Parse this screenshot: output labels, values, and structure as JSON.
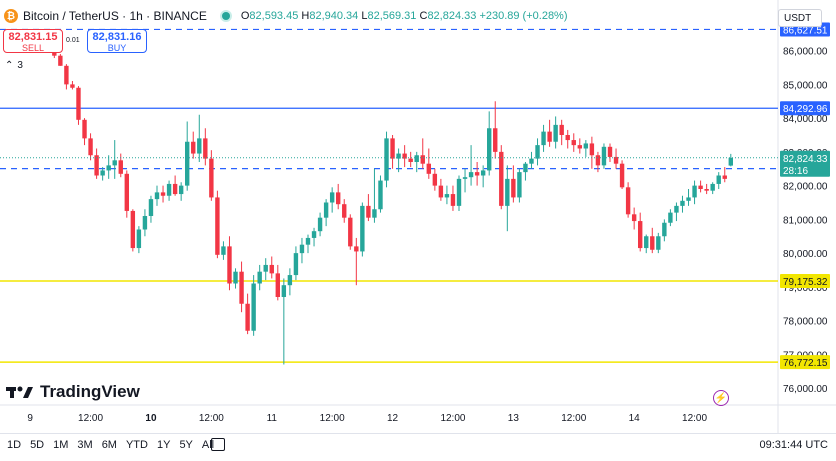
{
  "header": {
    "coin_glyph": "₿",
    "title": "Bitcoin / TetherUS · 1h · BINANCE",
    "open": "82,593.45",
    "high": "82,940.34",
    "low": "82,569.31",
    "close": "82,824.33",
    "change": "+230.89 (+0.28%)",
    "o_label": "O",
    "h_label": "H",
    "l_label": "L",
    "c_label": "C"
  },
  "trade": {
    "sell_price": "82,831.15",
    "sell_label": "SELL",
    "buy_price": "82,831.16",
    "buy_label": "BUY",
    "spread": "0.01"
  },
  "indicators_collapsed": "3",
  "currency_selector": "USDT",
  "brand": "TradingView",
  "ranges": [
    "1D",
    "5D",
    "1M",
    "3M",
    "6M",
    "YTD",
    "1Y",
    "5Y",
    "All"
  ],
  "clock": "09:31:44 UTC",
  "chart_data": {
    "type": "candlestick",
    "ylim": [
      75500,
      87500
    ],
    "y_ticks": [
      76000,
      77000,
      78000,
      79000,
      80000,
      81000,
      82000,
      83000,
      84000,
      85000,
      86000
    ],
    "y_tick_labels": [
      "76,000.00",
      "77,000.00",
      "78,000.00",
      "79,000.00",
      "80,000.00",
      "81,000.00",
      "82,000.00",
      "83,000.00",
      "84,000.00",
      "85,000.00",
      "86,000.00"
    ],
    "x_ticks": [
      "9",
      "12:00",
      "10",
      "12:00",
      "11",
      "12:00",
      "12",
      "12:00",
      "13",
      "12:00",
      "14",
      "12:00"
    ],
    "x_tick_bold": [
      false,
      false,
      true,
      false,
      false,
      false,
      false,
      false,
      false,
      false,
      false,
      false
    ],
    "x_tick_candle_index": [
      4,
      14,
      24,
      34,
      44,
      54,
      64,
      74,
      84,
      94,
      104,
      114
    ],
    "colors": {
      "up": "#26a69a",
      "down": "#f23645",
      "blue": "#2962ff",
      "yellow": "#f2e600"
    },
    "candles": [
      [
        86170,
        86300,
        86150,
        86180
      ],
      [
        86180,
        86240,
        86100,
        86200
      ],
      [
        86200,
        86280,
        86160,
        86250
      ],
      [
        86250,
        86330,
        86180,
        86280
      ],
      [
        86280,
        86330,
        86080,
        86120
      ],
      [
        86120,
        86200,
        86050,
        86080
      ],
      [
        86080,
        86150,
        85950,
        86010
      ],
      [
        86010,
        86120,
        85950,
        86050
      ],
      [
        86050,
        86120,
        85780,
        85850
      ],
      [
        85850,
        85900,
        85550,
        85550
      ],
      [
        85550,
        85600,
        84850,
        85000
      ],
      [
        85000,
        85100,
        84850,
        84900
      ],
      [
        84900,
        84950,
        83800,
        83950
      ],
      [
        83950,
        84000,
        83200,
        83400
      ],
      [
        83400,
        83550,
        82750,
        82900
      ],
      [
        82900,
        83100,
        82200,
        82300
      ],
      [
        82300,
        82550,
        82150,
        82450
      ],
      [
        82450,
        82900,
        82200,
        82600
      ],
      [
        82600,
        83350,
        82200,
        82750
      ],
      [
        82750,
        82950,
        82250,
        82350
      ],
      [
        82350,
        82450,
        81050,
        81250
      ],
      [
        81250,
        81300,
        80050,
        80150
      ],
      [
        80150,
        80800,
        80000,
        80700
      ],
      [
        80700,
        81300,
        80500,
        81100
      ],
      [
        81100,
        81700,
        80900,
        81600
      ],
      [
        81600,
        82000,
        81400,
        81800
      ],
      [
        81800,
        82000,
        81500,
        81700
      ],
      [
        81700,
        82150,
        81550,
        82050
      ],
      [
        82050,
        82300,
        81700,
        81750
      ],
      [
        81750,
        82100,
        81550,
        82000
      ],
      [
        82000,
        83900,
        81850,
        83300
      ],
      [
        83300,
        83600,
        82800,
        82950
      ],
      [
        82950,
        84100,
        82700,
        83400
      ],
      [
        83400,
        83700,
        82600,
        82800
      ],
      [
        82800,
        83050,
        81550,
        81650
      ],
      [
        81650,
        81850,
        79850,
        79950
      ],
      [
        79950,
        80350,
        79800,
        80200
      ],
      [
        80200,
        80500,
        78900,
        79100
      ],
      [
        79100,
        79550,
        78950,
        79450
      ],
      [
        79450,
        79750,
        78250,
        78500
      ],
      [
        78500,
        78800,
        77600,
        77700
      ],
      [
        77700,
        79350,
        77550,
        79100
      ],
      [
        79100,
        79650,
        78900,
        79450
      ],
      [
        79450,
        79850,
        79200,
        79650
      ],
      [
        79650,
        79900,
        79250,
        79400
      ],
      [
        79400,
        79650,
        78600,
        78700
      ],
      [
        78700,
        79250,
        76700,
        79050
      ],
      [
        79050,
        79550,
        78750,
        79350
      ],
      [
        79350,
        80200,
        79200,
        80000
      ],
      [
        80000,
        80450,
        79700,
        80250
      ],
      [
        80250,
        80550,
        80000,
        80450
      ],
      [
        80450,
        80750,
        80200,
        80650
      ],
      [
        80650,
        81200,
        80500,
        81050
      ],
      [
        81050,
        81600,
        80800,
        81500
      ],
      [
        81500,
        81950,
        81200,
        81800
      ],
      [
        81800,
        82050,
        81300,
        81450
      ],
      [
        81450,
        81600,
        80900,
        81050
      ],
      [
        81050,
        81150,
        80100,
        80200
      ],
      [
        80200,
        80450,
        79050,
        80050
      ],
      [
        80050,
        81500,
        79900,
        81400
      ],
      [
        81400,
        81750,
        80950,
        81050
      ],
      [
        81050,
        82500,
        80900,
        81300
      ],
      [
        81300,
        82300,
        81200,
        82150
      ],
      [
        82150,
        83600,
        81950,
        83400
      ],
      [
        83400,
        83500,
        82500,
        82800
      ],
      [
        82800,
        83100,
        82400,
        82950
      ],
      [
        82950,
        83200,
        82550,
        82800
      ],
      [
        82800,
        83000,
        82550,
        82700
      ],
      [
        82700,
        83000,
        82400,
        82900
      ],
      [
        82900,
        83400,
        82500,
        82650
      ],
      [
        82650,
        83100,
        82200,
        82350
      ],
      [
        82350,
        82500,
        81850,
        82000
      ],
      [
        82000,
        82200,
        81550,
        81650
      ],
      [
        81650,
        82000,
        81450,
        81750
      ],
      [
        81750,
        82000,
        81250,
        81400
      ],
      [
        81400,
        82300,
        81250,
        82200
      ],
      [
        82200,
        82500,
        81800,
        82250
      ],
      [
        82250,
        83200,
        82000,
        82400
      ],
      [
        82400,
        82700,
        82000,
        82300
      ],
      [
        82300,
        82600,
        81950,
        82450
      ],
      [
        82450,
        84200,
        82300,
        83700
      ],
      [
        83700,
        84500,
        82800,
        83000
      ],
      [
        83000,
        83200,
        81300,
        81400
      ],
      [
        81400,
        82600,
        80650,
        82200
      ],
      [
        82200,
        82600,
        81500,
        81650
      ],
      [
        81650,
        82500,
        81500,
        82400
      ],
      [
        82400,
        82700,
        82150,
        82650
      ],
      [
        82650,
        83000,
        82500,
        82800
      ],
      [
        82800,
        83400,
        82600,
        83200
      ],
      [
        83200,
        83800,
        83000,
        83600
      ],
      [
        83600,
        83950,
        83150,
        83300
      ],
      [
        83300,
        84050,
        83100,
        83800
      ],
      [
        83800,
        83950,
        83200,
        83500
      ],
      [
        83500,
        83650,
        83100,
        83350
      ],
      [
        83350,
        83550,
        83000,
        83200
      ],
      [
        83200,
        83400,
        82950,
        83100
      ],
      [
        83100,
        83350,
        82850,
        83250
      ],
      [
        83250,
        83450,
        82500,
        82900
      ],
      [
        82900,
        83000,
        82400,
        82600
      ],
      [
        82600,
        83250,
        82500,
        83150
      ],
      [
        83150,
        83250,
        82700,
        82850
      ],
      [
        82850,
        83100,
        82500,
        82650
      ],
      [
        82650,
        82750,
        81900,
        81950
      ],
      [
        81950,
        82100,
        81050,
        81150
      ],
      [
        81150,
        81350,
        80700,
        80950
      ],
      [
        80950,
        81200,
        80050,
        80150
      ],
      [
        80150,
        80550,
        80000,
        80500
      ],
      [
        80500,
        80750,
        80000,
        80100
      ],
      [
        80100,
        80600,
        80000,
        80500
      ],
      [
        80500,
        81000,
        80350,
        80900
      ],
      [
        80900,
        81300,
        80800,
        81200
      ],
      [
        81200,
        81500,
        80950,
        81400
      ],
      [
        81400,
        81700,
        81200,
        81550
      ],
      [
        81550,
        81900,
        81400,
        81650
      ],
      [
        81650,
        82150,
        81450,
        82000
      ],
      [
        82000,
        82150,
        81800,
        81900
      ],
      [
        81900,
        82050,
        81750,
        81850
      ],
      [
        81850,
        82100,
        81750,
        82050
      ],
      [
        82050,
        82400,
        81900,
        82300
      ],
      [
        82300,
        82550,
        82100,
        82200
      ],
      [
        82593.45,
        82940.34,
        82569.31,
        82824.33
      ]
    ],
    "levels": [
      {
        "value": 86627.51,
        "label": "86,627.51",
        "color": "#2962ff",
        "style": "dashed"
      },
      {
        "value": 84292.96,
        "label": "84,292.96",
        "color": "#2962ff",
        "style": "solid"
      },
      {
        "value": 82503.72,
        "label": "82,503.72",
        "color": "#2962ff",
        "style": "dashed"
      },
      {
        "value": 79175.32,
        "label": "79,175.32",
        "color": "#f2e600",
        "style": "solid"
      },
      {
        "value": 76772.15,
        "label": "76,772.15",
        "color": "#f2e600",
        "style": "solid"
      }
    ],
    "last_price": {
      "value": 82824.33,
      "label": "82,824.33",
      "countdown": "28:16"
    }
  }
}
